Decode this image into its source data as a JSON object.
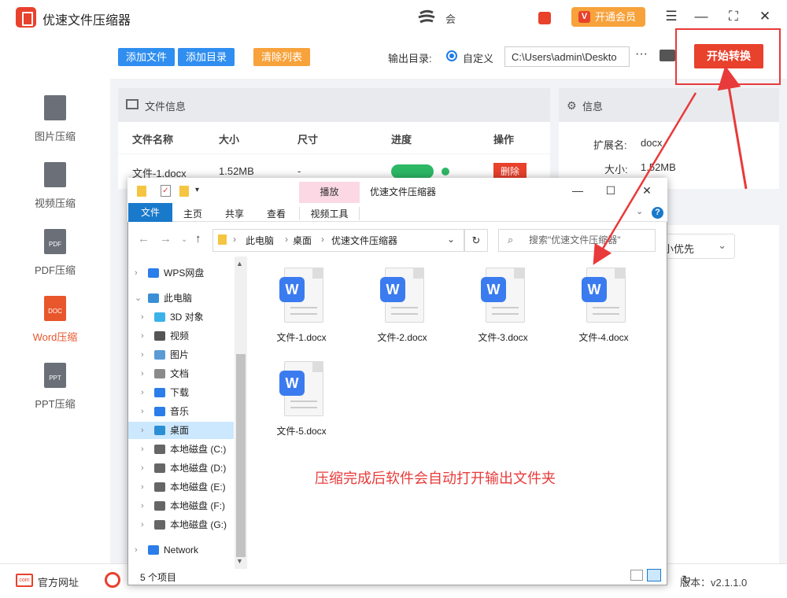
{
  "app": {
    "title": "优速文件压缩器",
    "vip_label": "开通会员",
    "user_label": "会"
  },
  "sidebar": {
    "items": [
      {
        "label": "图片压缩",
        "icon": "image-file-icon",
        "active": false
      },
      {
        "label": "视频压缩",
        "icon": "video-file-icon",
        "active": false
      },
      {
        "label": "PDF压缩",
        "icon": "pdf-file-icon",
        "active": false,
        "badge": "PDF"
      },
      {
        "label": "Word压缩",
        "icon": "word-file-icon",
        "active": true,
        "badge": "DOC"
      },
      {
        "label": "PPT压缩",
        "icon": "ppt-file-icon",
        "active": false,
        "badge": "PPT"
      }
    ]
  },
  "toolbar": {
    "add_file": "添加文件",
    "add_dir": "添加目录",
    "clear_list": "清除列表",
    "output_label": "输出目录:",
    "radio_label": "自定义",
    "path": "C:\\Users\\admin\\Deskto",
    "more": "···",
    "start": "开始转换"
  },
  "file_panel": {
    "title": "文件信息",
    "columns": [
      "文件名称",
      "大小",
      "尺寸",
      "进度",
      "操作"
    ],
    "rows": [
      {
        "name": "文件-1.docx",
        "size": "1.52MB",
        "dim": "-",
        "action": "删除"
      }
    ]
  },
  "info_panel": {
    "title": "信息",
    "ext_label": "扩展名:",
    "ext_value": "docx",
    "size_label": "大小:",
    "size_value": "1.52MB",
    "mode_value": "小优先"
  },
  "footer": {
    "site": "官方网址",
    "version_label": "版本：",
    "version": "v2.1.1.0"
  },
  "explorer": {
    "title": "优速文件压缩器",
    "play_tab": "播放",
    "video_tools": "视频工具",
    "tabs": [
      "文件",
      "主页",
      "共享",
      "查看"
    ],
    "breadcrumb": [
      "此电脑",
      "桌面",
      "优速文件压缩器"
    ],
    "search_placeholder": "搜索\"优速文件压缩器\"",
    "tree": [
      {
        "label": "WPS网盘",
        "level": 0,
        "color": "#2b7de9"
      },
      {
        "label": "此电脑",
        "level": 0,
        "color": "#3a8fd6",
        "open": true
      },
      {
        "label": "3D 对象",
        "level": 1,
        "color": "#3bb3e8"
      },
      {
        "label": "视频",
        "level": 1,
        "color": "#555"
      },
      {
        "label": "图片",
        "level": 1,
        "color": "#5b9bd5"
      },
      {
        "label": "文档",
        "level": 1,
        "color": "#8a8a8a"
      },
      {
        "label": "下载",
        "level": 1,
        "color": "#2b7de9"
      },
      {
        "label": "音乐",
        "level": 1,
        "color": "#2b7de9"
      },
      {
        "label": "桌面",
        "level": 1,
        "color": "#2b8fd6",
        "selected": true
      },
      {
        "label": "本地磁盘 (C:)",
        "level": 1,
        "color": "#666"
      },
      {
        "label": "本地磁盘 (D:)",
        "level": 1,
        "color": "#666"
      },
      {
        "label": "本地磁盘 (E:)",
        "level": 1,
        "color": "#666"
      },
      {
        "label": "本地磁盘 (F:)",
        "level": 1,
        "color": "#666"
      },
      {
        "label": "本地磁盘 (G:)",
        "level": 1,
        "color": "#666"
      },
      {
        "label": "Network",
        "level": 0,
        "color": "#2b7de9"
      }
    ],
    "files": [
      "文件-1.docx",
      "文件-2.docx",
      "文件-3.docx",
      "文件-4.docx",
      "文件-5.docx"
    ],
    "status": "5 个项目",
    "note": "压缩完成后软件会自动打开输出文件夹"
  }
}
